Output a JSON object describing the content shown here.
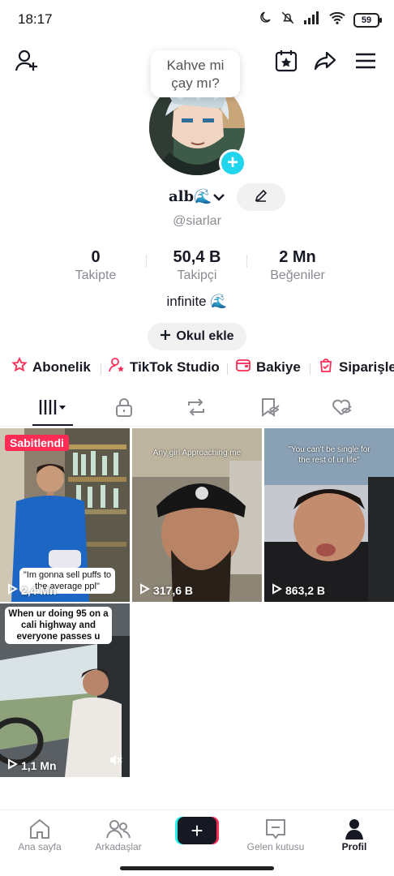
{
  "status_bar": {
    "time": "18:17",
    "battery": "59"
  },
  "bubble": {
    "line1": "Kahve mi",
    "line2": "çay mı?"
  },
  "profile": {
    "display_name": "alb🌊",
    "handle": "@siarlar",
    "bio": "infinite 🌊",
    "school_button": "Okul ekle"
  },
  "stats": [
    {
      "value": "0",
      "label": "Takipte"
    },
    {
      "value": "50,4 B",
      "label": "Takipçi"
    },
    {
      "value": "2 Mn",
      "label": "Beğeniler"
    }
  ],
  "quick_links": [
    {
      "label": "Abonelik",
      "icon": "subscription-icon"
    },
    {
      "label": "TikTok Studio",
      "icon": "studio-icon"
    },
    {
      "label": "Bakiye",
      "icon": "wallet-icon"
    },
    {
      "label": "Siparişle",
      "icon": "orders-icon"
    }
  ],
  "tabs": [
    "videos-tab",
    "private-tab",
    "reposts-tab",
    "favorites-tab",
    "liked-tab"
  ],
  "videos": [
    {
      "views": "2,4 Mn",
      "pinned": "Sabitlendi",
      "caption": "\"Im gonna sell puffs to\nthe average ppl\""
    },
    {
      "views": "317,6 B",
      "caption": "Any girl Approaching me"
    },
    {
      "views": "863,2 B",
      "caption": "\"You can't be single for\nthe rest of ur life\""
    },
    {
      "views": "1,1 Mn",
      "caption": "When ur doing 95 on a\ncali highway and\neveryone passes u"
    }
  ],
  "bottom_nav": [
    {
      "label": "Ana sayfa",
      "icon": "home-icon"
    },
    {
      "label": "Arkadaşlar",
      "icon": "friends-icon"
    },
    {
      "label": "",
      "icon": "create-icon"
    },
    {
      "label": "Gelen kutusu",
      "icon": "inbox-icon"
    },
    {
      "label": "Profil",
      "icon": "profile-icon"
    }
  ],
  "colors": {
    "accent": "#fe2c55",
    "cyan": "#20d5ec",
    "text": "#161823",
    "muted": "#8a8b91"
  }
}
